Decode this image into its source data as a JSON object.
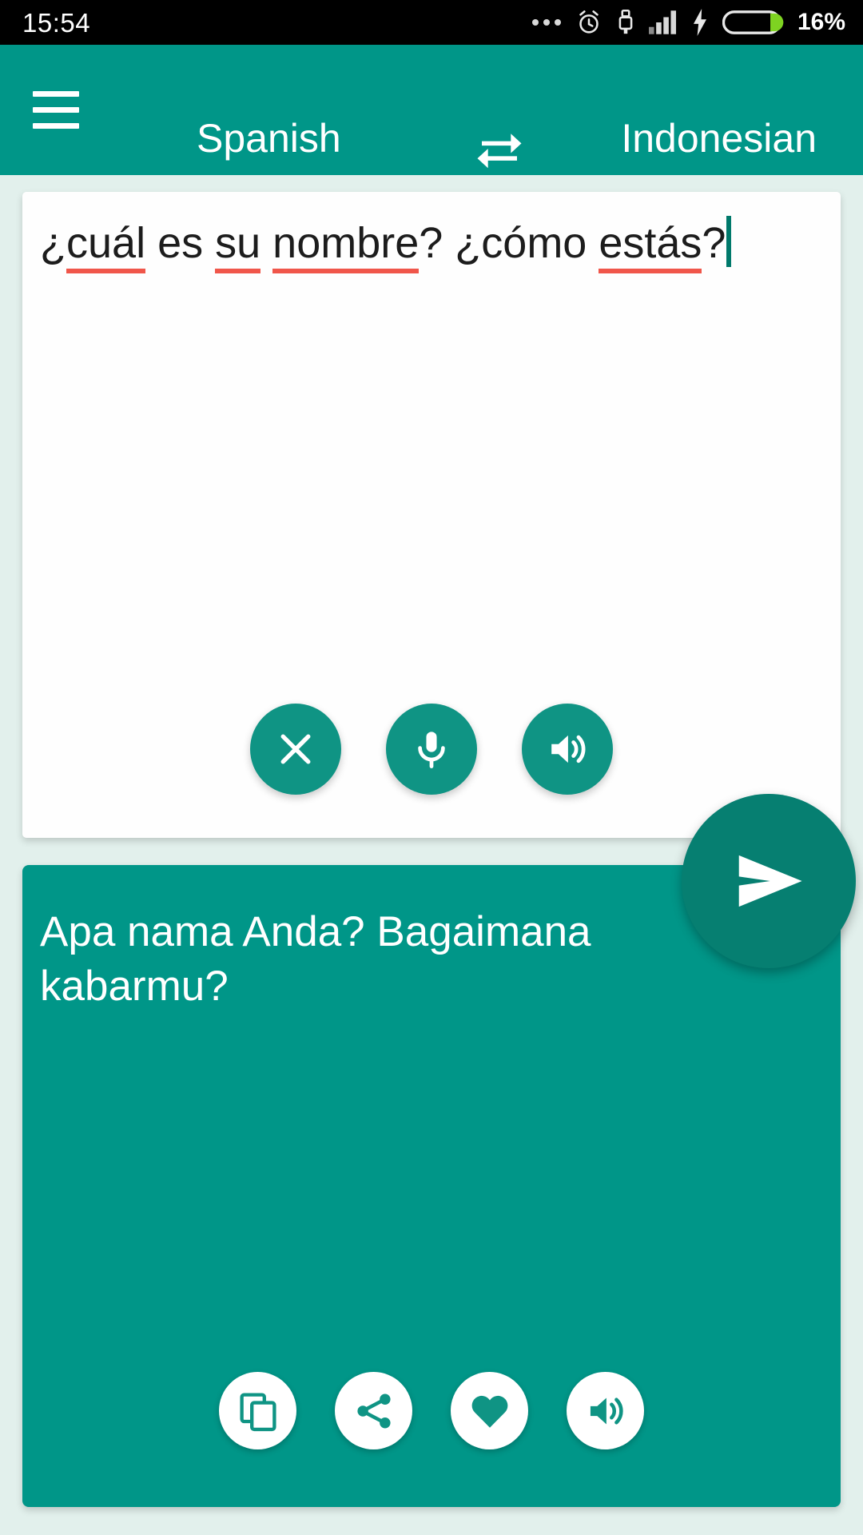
{
  "status_bar": {
    "clock": "15:54",
    "battery_percent": "16%",
    "icons": [
      "more-dots-icon",
      "alarm-clock-icon",
      "usb-icon",
      "signal-bars-icon",
      "charging-bolt-icon",
      "battery-icon"
    ],
    "battery_fill_color": "#7ed321",
    "background_color": "#000000"
  },
  "app_bar": {
    "menu_icon": "hamburger-menu-icon",
    "source_language": "Spanish",
    "swap_icon": "swap-languages-icon",
    "target_language": "Indonesian",
    "background_color": "#009688"
  },
  "source_card": {
    "text_full": "¿cuál es su nombre? ¿cómo estás?",
    "segments": [
      {
        "t": "¿",
        "misspelled": false
      },
      {
        "t": "cuál",
        "misspelled": true
      },
      {
        "t": " es ",
        "misspelled": false
      },
      {
        "t": "su",
        "misspelled": true
      },
      {
        "t": " ",
        "misspelled": false
      },
      {
        "t": "nombre",
        "misspelled": true
      },
      {
        "t": "? ¿cómo ",
        "misspelled": false
      },
      {
        "t": "estás",
        "misspelled": true
      },
      {
        "t": "?",
        "misspelled": false
      }
    ],
    "spellcheck_underline_color": "#f0564a",
    "caret_color": "#00796b",
    "background_color": "#fefefe",
    "actions": [
      {
        "name": "clear-button",
        "icon": "close-x-icon"
      },
      {
        "name": "microphone-button",
        "icon": "microphone-icon"
      },
      {
        "name": "speak-source-button",
        "icon": "speaker-icon"
      }
    ]
  },
  "send_button": {
    "icon": "send-icon",
    "color": "#067f71"
  },
  "target_card": {
    "text": "Apa nama Anda? Bagaimana kabarmu?",
    "background_color": "#009688",
    "text_color": "#ffffff",
    "actions": [
      {
        "name": "copy-button",
        "icon": "copy-icon"
      },
      {
        "name": "share-button",
        "icon": "share-icon"
      },
      {
        "name": "favorite-button",
        "icon": "heart-icon"
      },
      {
        "name": "speak-translation-button",
        "icon": "speaker-icon"
      }
    ]
  },
  "page_background_color": "#e2f0ec"
}
